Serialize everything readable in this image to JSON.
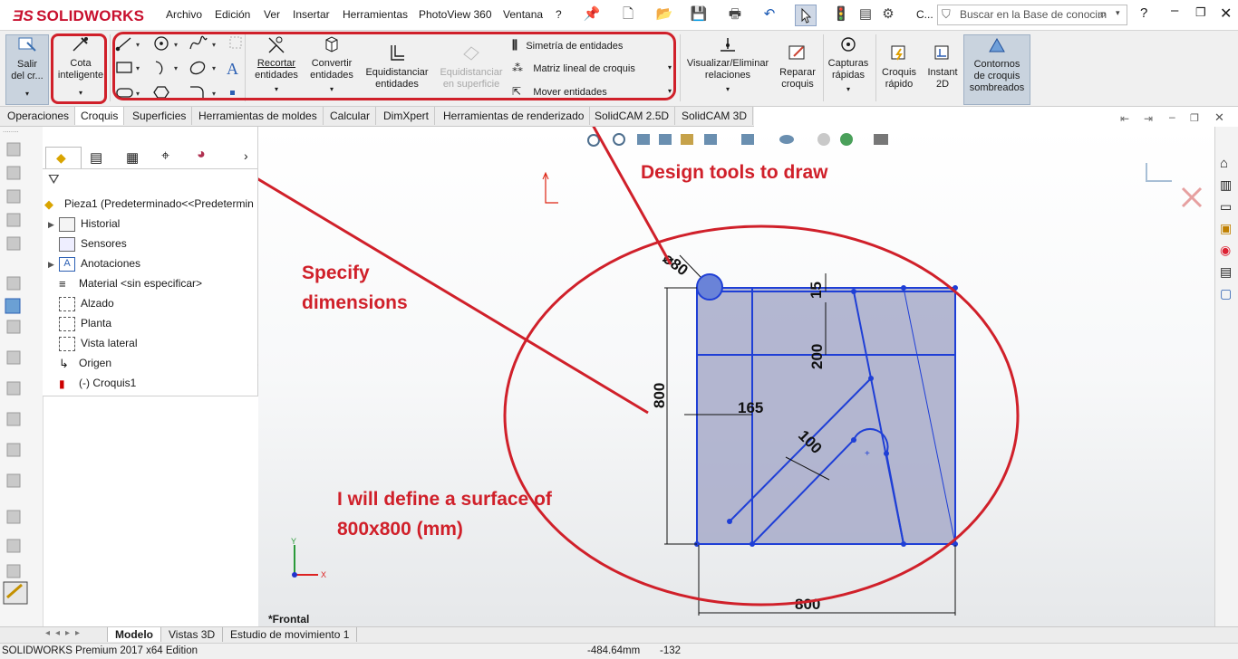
{
  "app": {
    "logo": "SOLIDWORKS"
  },
  "menu": [
    "Archivo",
    "Edición",
    "Ver",
    "Insertar",
    "Herramientas",
    "PhotoView 360",
    "Ventana",
    "?"
  ],
  "toolbar": {
    "c_label": "C...",
    "search_placeholder": "Buscar en la Base de conocim",
    "help": "?"
  },
  "ribbon": {
    "exit_sketch": [
      "Salir",
      "del cr..."
    ],
    "smart_dim": [
      "Cota",
      "inteligente"
    ],
    "trim": [
      "Recortar",
      "entidades"
    ],
    "convert": [
      "Convertir",
      "entidades"
    ],
    "offset": [
      "Equidistanciar",
      "entidades"
    ],
    "offset_surface": [
      "Equidistanciar",
      "en superficie"
    ],
    "mirror": "Simetría de entidades",
    "linear_pattern": "Matriz lineal de croquis",
    "move": "Mover entidades",
    "relations": [
      "Visualizar/Eliminar",
      "relaciones"
    ],
    "repair": [
      "Reparar",
      "croquis"
    ],
    "quick_snaps": [
      "Capturas",
      "rápidas"
    ],
    "rapid_sketch": [
      "Croquis",
      "rápido"
    ],
    "instant2d": [
      "Instant",
      "2D"
    ],
    "shaded": [
      "Contornos",
      "de croquis",
      "sombreados"
    ]
  },
  "tabs": [
    "Operaciones",
    "Croquis",
    "Superficies",
    "Herramientas de moldes",
    "Calcular",
    "DimXpert",
    "Herramientas de renderizado",
    "SolidCAM 2.5D",
    "SolidCAM 3D"
  ],
  "active_tab": "Croquis",
  "tree": {
    "root": "Pieza1  (Predeterminado<<Predetermin",
    "items": [
      "Historial",
      "Sensores",
      "Anotaciones",
      "Material <sin especificar>",
      "Alzado",
      "Planta",
      "Vista lateral",
      "Origen",
      "(-) Croquis1"
    ]
  },
  "viewport": {
    "view_name": "*Frontal"
  },
  "dimensions": {
    "diameter": "⌀80",
    "d15": "15",
    "d200": "200",
    "d800v": "800",
    "d165": "165",
    "d100": "100",
    "d800h": "800"
  },
  "annotations": {
    "design_tools": "Design tools to draw",
    "specify": [
      "Specify",
      "dimensions"
    ],
    "surface": [
      "I will define a surface of",
      "800x800 (mm)"
    ]
  },
  "bottom_tabs": [
    "Modelo",
    "Vistas 3D",
    "Estudio de movimiento 1"
  ],
  "status": {
    "edition": "SOLIDWORKS Premium 2017 x64 Edition",
    "x": "-484.64mm",
    "y": "-132"
  },
  "colors": {
    "accent": "#c8102e",
    "annotation": "#d0202a",
    "sketch": "#1f3fd6",
    "fill": "#a7aac9"
  }
}
